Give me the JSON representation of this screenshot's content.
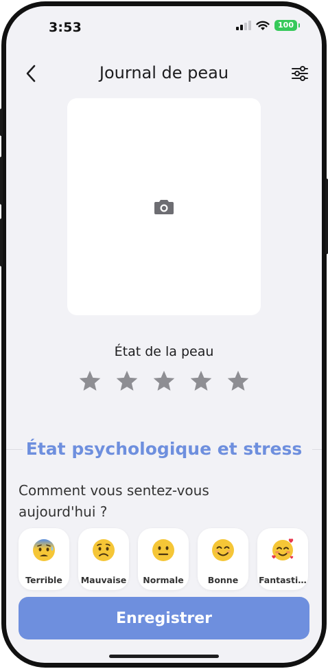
{
  "status_bar": {
    "time": "3:53",
    "battery": "100"
  },
  "header": {
    "title": "Journal de peau",
    "back_icon": "chevron-left-icon",
    "filter_icon": "sliders-icon"
  },
  "photo": {
    "icon": "camera-icon"
  },
  "skin_rating": {
    "label": "État de la peau",
    "max_stars": 5,
    "value": 0,
    "star_color": "#8e8e93"
  },
  "psych_section": {
    "title": "État psychologique et stress",
    "question": "Comment vous sentez-vous aujourd'hui ?",
    "moods": [
      {
        "label": "Terrible",
        "icon": "anxious-sweat-face-icon"
      },
      {
        "label": "Mauvaise",
        "icon": "worried-face-icon"
      },
      {
        "label": "Normale",
        "icon": "neutral-face-icon"
      },
      {
        "label": "Bonne",
        "icon": "smiling-face-icon"
      },
      {
        "label": "Fantastique",
        "icon": "smiling-face-with-hearts-icon"
      }
    ]
  },
  "save_button": {
    "label": "Enregistrer"
  },
  "colors": {
    "accent": "#6e8fde",
    "background": "#f2f2f6",
    "battery": "#36c95a"
  }
}
